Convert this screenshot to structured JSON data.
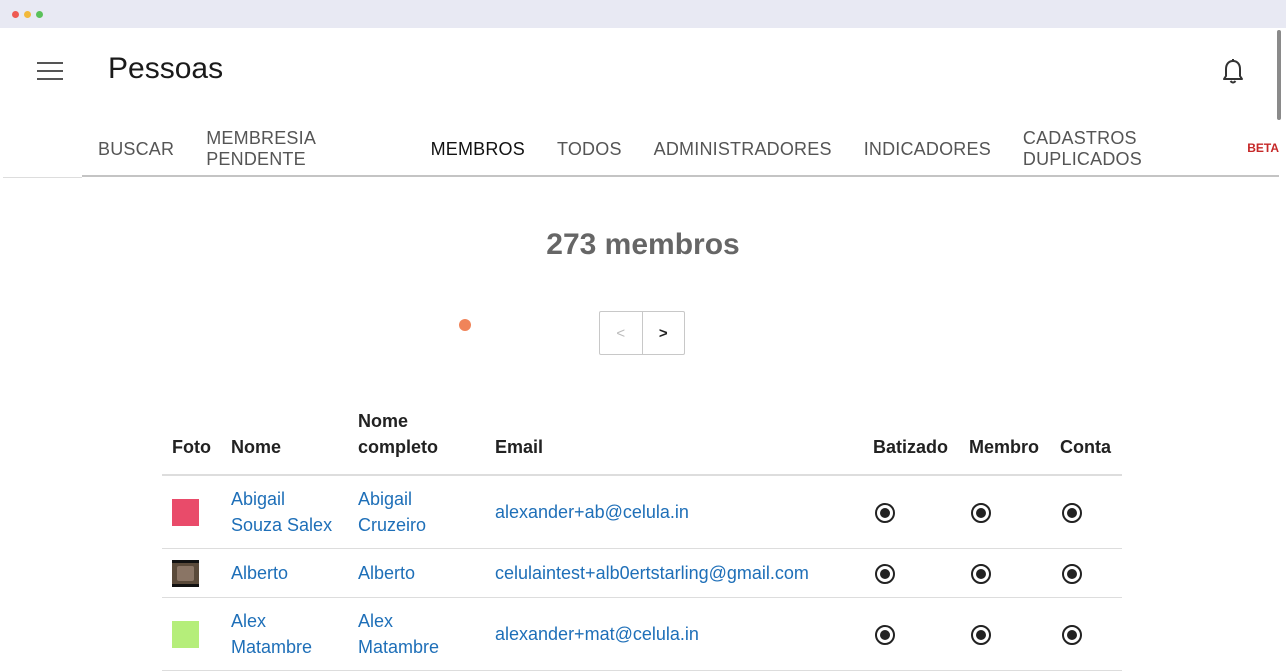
{
  "header": {
    "title": "Pessoas",
    "menu_icon": "menu-icon",
    "notification_icon": "bell-icon"
  },
  "tabs": [
    {
      "label": "BUSCAR",
      "active": false
    },
    {
      "label": "MEMBRESIA PENDENTE",
      "active": false
    },
    {
      "label": "MEMBROS",
      "active": true
    },
    {
      "label": "TODOS",
      "active": false
    },
    {
      "label": "ADMINISTRADORES",
      "active": false
    },
    {
      "label": "INDICADORES",
      "active": false
    },
    {
      "label": "CADASTROS DUPLICADOS",
      "active": false,
      "badge": "BETA"
    }
  ],
  "summary": {
    "count_text": "273 membros"
  },
  "pager": {
    "prev": "<",
    "next": ">"
  },
  "table": {
    "headers": {
      "foto": "Foto",
      "nome": "Nome",
      "nome_completo_1": "Nome",
      "nome_completo_2": "completo",
      "email": "Email",
      "batizado": "Batizado",
      "membro": "Membro",
      "conta": "Conta"
    },
    "rows": [
      {
        "photo_color": "#e94b6a",
        "nome_1": "Abigail",
        "nome_2": "Souza Salex",
        "completo_1": "Abigail",
        "completo_2": "Cruzeiro",
        "email": "alexander+ab@celula.in"
      },
      {
        "photo_color": "#5a4a3a",
        "nome_1": "Alberto",
        "nome_2": "",
        "completo_1": "Alberto",
        "completo_2": "",
        "email": "celulaintest+alb0ertstarling@gmail.com"
      },
      {
        "photo_color": "#b5ee7a",
        "nome_1": "Alex",
        "nome_2": "Matambre",
        "completo_1": "Alex",
        "completo_2": "Matambre",
        "email": "alexander+mat@celula.in"
      }
    ]
  },
  "colors": {
    "link": "#1e6fb8",
    "beta": "#c62828",
    "loader": "#f0845a"
  }
}
